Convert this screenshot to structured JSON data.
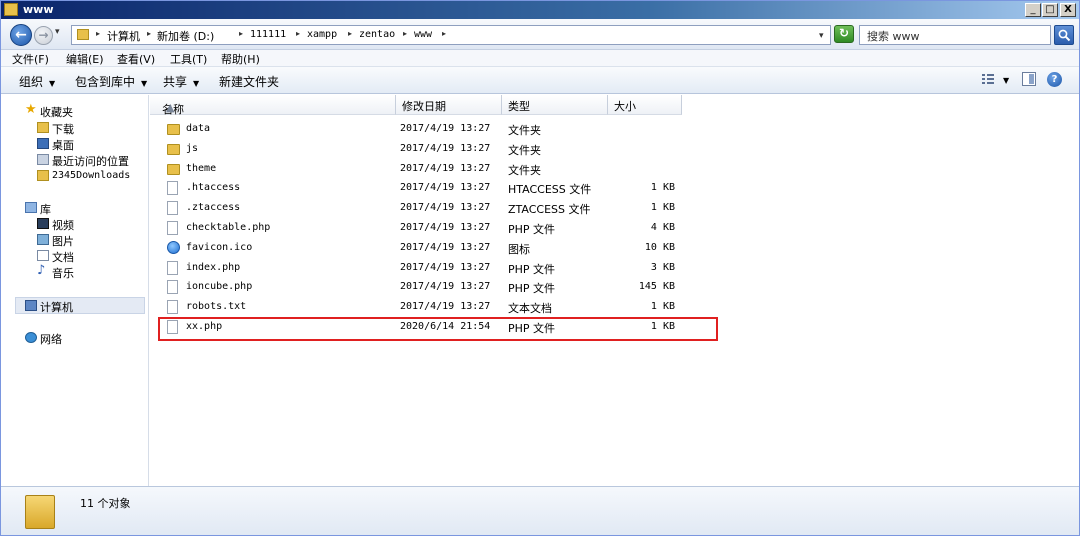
{
  "window": {
    "title": "www",
    "controls": {
      "minimize": "_",
      "maximize": "□",
      "close": "X"
    }
  },
  "address": {
    "crumbs": [
      "计算机",
      "新加卷 (D:)",
      "111111",
      "xampp",
      "zentao",
      "www"
    ],
    "search_placeholder": "搜索 www"
  },
  "menu": [
    "文件(F)",
    "编辑(E)",
    "查看(V)",
    "工具(T)",
    "帮助(H)"
  ],
  "commands": {
    "organize": "组织",
    "include_library": "包含到库中",
    "share": "共享",
    "new_folder": "新建文件夹"
  },
  "nav": {
    "favorites": {
      "label": "收藏夹",
      "items": [
        "下载",
        "桌面",
        "最近访问的位置",
        "2345Downloads"
      ]
    },
    "libraries": {
      "label": "库",
      "items": [
        "视频",
        "图片",
        "文档",
        "音乐"
      ]
    },
    "computer": "计算机",
    "network": "网络"
  },
  "columns": {
    "name": "名称",
    "date": "修改日期",
    "type": "类型",
    "size": "大小"
  },
  "files": [
    {
      "name": "data",
      "date": "2017/4/19 13:27",
      "type": "文件夹",
      "size": "",
      "icon": "folder"
    },
    {
      "name": "js",
      "date": "2017/4/19 13:27",
      "type": "文件夹",
      "size": "",
      "icon": "folder"
    },
    {
      "name": "theme",
      "date": "2017/4/19 13:27",
      "type": "文件夹",
      "size": "",
      "icon": "folder"
    },
    {
      "name": ".htaccess",
      "date": "2017/4/19 13:27",
      "type": "HTACCESS 文件",
      "size": "1 KB",
      "icon": "doc"
    },
    {
      "name": ".ztaccess",
      "date": "2017/4/19 13:27",
      "type": "ZTACCESS 文件",
      "size": "1 KB",
      "icon": "doc"
    },
    {
      "name": "checktable.php",
      "date": "2017/4/19 13:27",
      "type": "PHP 文件",
      "size": "4 KB",
      "icon": "doc"
    },
    {
      "name": "favicon.ico",
      "date": "2017/4/19 13:27",
      "type": "图标",
      "size": "10 KB",
      "icon": "ico"
    },
    {
      "name": "index.php",
      "date": "2017/4/19 13:27",
      "type": "PHP 文件",
      "size": "3 KB",
      "icon": "doc"
    },
    {
      "name": "ioncube.php",
      "date": "2017/4/19 13:27",
      "type": "PHP 文件",
      "size": "145 KB",
      "icon": "doc"
    },
    {
      "name": "robots.txt",
      "date": "2017/4/19 13:27",
      "type": "文本文档",
      "size": "1 KB",
      "icon": "doc"
    },
    {
      "name": "xx.php",
      "date": "2020/6/14 21:54",
      "type": "PHP 文件",
      "size": "1 KB",
      "icon": "doc"
    }
  ],
  "status": {
    "count": "11 个对象"
  },
  "colors": {
    "highlight": "#e02020",
    "titlebar": "#0a246a"
  }
}
